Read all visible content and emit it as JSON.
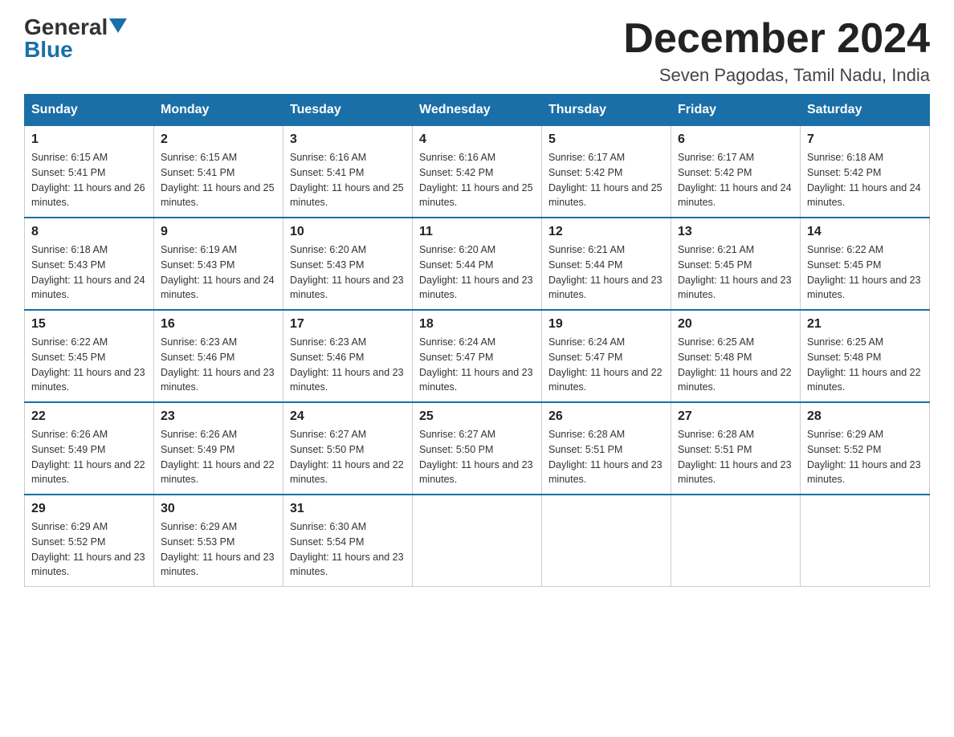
{
  "logo": {
    "general": "General",
    "blue": "Blue"
  },
  "title": "December 2024",
  "subtitle": "Seven Pagodas, Tamil Nadu, India",
  "days": [
    "Sunday",
    "Monday",
    "Tuesday",
    "Wednesday",
    "Thursday",
    "Friday",
    "Saturday"
  ],
  "weeks": [
    [
      {
        "day": "1",
        "sunrise": "6:15 AM",
        "sunset": "5:41 PM",
        "daylight": "11 hours and 26 minutes."
      },
      {
        "day": "2",
        "sunrise": "6:15 AM",
        "sunset": "5:41 PM",
        "daylight": "11 hours and 25 minutes."
      },
      {
        "day": "3",
        "sunrise": "6:16 AM",
        "sunset": "5:41 PM",
        "daylight": "11 hours and 25 minutes."
      },
      {
        "day": "4",
        "sunrise": "6:16 AM",
        "sunset": "5:42 PM",
        "daylight": "11 hours and 25 minutes."
      },
      {
        "day": "5",
        "sunrise": "6:17 AM",
        "sunset": "5:42 PM",
        "daylight": "11 hours and 25 minutes."
      },
      {
        "day": "6",
        "sunrise": "6:17 AM",
        "sunset": "5:42 PM",
        "daylight": "11 hours and 24 minutes."
      },
      {
        "day": "7",
        "sunrise": "6:18 AM",
        "sunset": "5:42 PM",
        "daylight": "11 hours and 24 minutes."
      }
    ],
    [
      {
        "day": "8",
        "sunrise": "6:18 AM",
        "sunset": "5:43 PM",
        "daylight": "11 hours and 24 minutes."
      },
      {
        "day": "9",
        "sunrise": "6:19 AM",
        "sunset": "5:43 PM",
        "daylight": "11 hours and 24 minutes."
      },
      {
        "day": "10",
        "sunrise": "6:20 AM",
        "sunset": "5:43 PM",
        "daylight": "11 hours and 23 minutes."
      },
      {
        "day": "11",
        "sunrise": "6:20 AM",
        "sunset": "5:44 PM",
        "daylight": "11 hours and 23 minutes."
      },
      {
        "day": "12",
        "sunrise": "6:21 AM",
        "sunset": "5:44 PM",
        "daylight": "11 hours and 23 minutes."
      },
      {
        "day": "13",
        "sunrise": "6:21 AM",
        "sunset": "5:45 PM",
        "daylight": "11 hours and 23 minutes."
      },
      {
        "day": "14",
        "sunrise": "6:22 AM",
        "sunset": "5:45 PM",
        "daylight": "11 hours and 23 minutes."
      }
    ],
    [
      {
        "day": "15",
        "sunrise": "6:22 AM",
        "sunset": "5:45 PM",
        "daylight": "11 hours and 23 minutes."
      },
      {
        "day": "16",
        "sunrise": "6:23 AM",
        "sunset": "5:46 PM",
        "daylight": "11 hours and 23 minutes."
      },
      {
        "day": "17",
        "sunrise": "6:23 AM",
        "sunset": "5:46 PM",
        "daylight": "11 hours and 23 minutes."
      },
      {
        "day": "18",
        "sunrise": "6:24 AM",
        "sunset": "5:47 PM",
        "daylight": "11 hours and 23 minutes."
      },
      {
        "day": "19",
        "sunrise": "6:24 AM",
        "sunset": "5:47 PM",
        "daylight": "11 hours and 22 minutes."
      },
      {
        "day": "20",
        "sunrise": "6:25 AM",
        "sunset": "5:48 PM",
        "daylight": "11 hours and 22 minutes."
      },
      {
        "day": "21",
        "sunrise": "6:25 AM",
        "sunset": "5:48 PM",
        "daylight": "11 hours and 22 minutes."
      }
    ],
    [
      {
        "day": "22",
        "sunrise": "6:26 AM",
        "sunset": "5:49 PM",
        "daylight": "11 hours and 22 minutes."
      },
      {
        "day": "23",
        "sunrise": "6:26 AM",
        "sunset": "5:49 PM",
        "daylight": "11 hours and 22 minutes."
      },
      {
        "day": "24",
        "sunrise": "6:27 AM",
        "sunset": "5:50 PM",
        "daylight": "11 hours and 22 minutes."
      },
      {
        "day": "25",
        "sunrise": "6:27 AM",
        "sunset": "5:50 PM",
        "daylight": "11 hours and 23 minutes."
      },
      {
        "day": "26",
        "sunrise": "6:28 AM",
        "sunset": "5:51 PM",
        "daylight": "11 hours and 23 minutes."
      },
      {
        "day": "27",
        "sunrise": "6:28 AM",
        "sunset": "5:51 PM",
        "daylight": "11 hours and 23 minutes."
      },
      {
        "day": "28",
        "sunrise": "6:29 AM",
        "sunset": "5:52 PM",
        "daylight": "11 hours and 23 minutes."
      }
    ],
    [
      {
        "day": "29",
        "sunrise": "6:29 AM",
        "sunset": "5:52 PM",
        "daylight": "11 hours and 23 minutes."
      },
      {
        "day": "30",
        "sunrise": "6:29 AM",
        "sunset": "5:53 PM",
        "daylight": "11 hours and 23 minutes."
      },
      {
        "day": "31",
        "sunrise": "6:30 AM",
        "sunset": "5:54 PM",
        "daylight": "11 hours and 23 minutes."
      },
      null,
      null,
      null,
      null
    ]
  ]
}
